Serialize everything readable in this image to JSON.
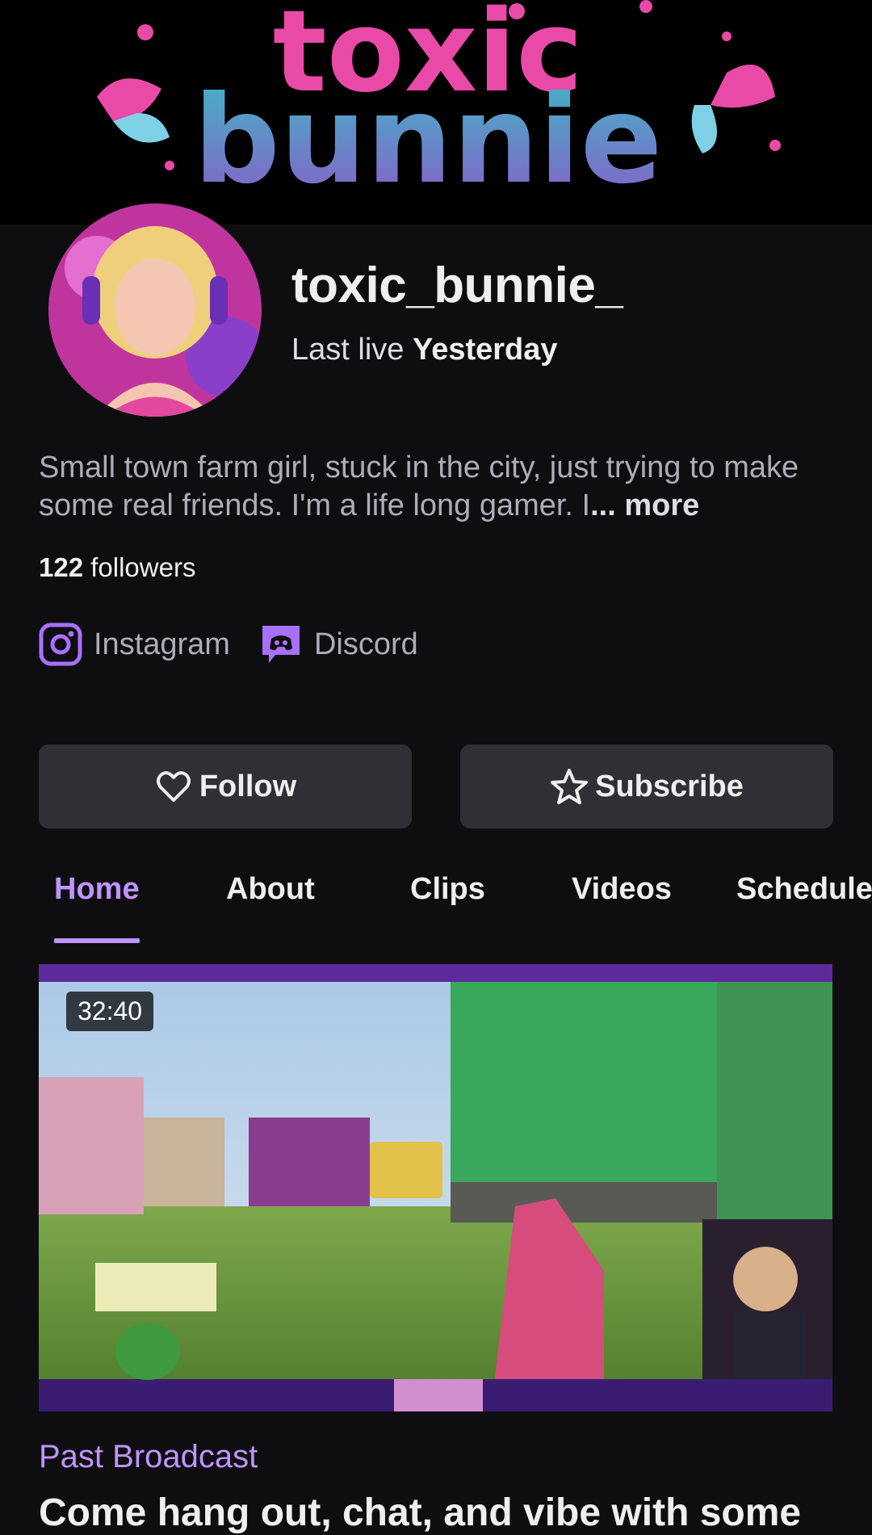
{
  "banner": {
    "logo_text_line1": "toxic",
    "logo_text_line2": "bunnie"
  },
  "profile": {
    "channel_name": "toxic_bunnie_",
    "last_live_label": "Last live",
    "last_live_value": "Yesterday",
    "bio": "Small town farm girl, stuck in the city, just trying to make some real friends. I'm a life long gamer. I",
    "bio_more": "... more",
    "followers_count": "122",
    "followers_label": "followers"
  },
  "socials": [
    {
      "label": "Instagram",
      "icon": "instagram-icon"
    },
    {
      "label": "Discord",
      "icon": "discord-icon"
    }
  ],
  "actions": {
    "follow_label": "Follow",
    "subscribe_label": "Subscribe"
  },
  "tabs": [
    {
      "label": "Home",
      "active": true
    },
    {
      "label": "About"
    },
    {
      "label": "Clips"
    },
    {
      "label": "Videos"
    },
    {
      "label": "Schedule"
    }
  ],
  "video": {
    "duration": "32:40",
    "category_label": "Past Broadcast",
    "title": "Come hang out, chat, and vibe with some"
  },
  "colors": {
    "background": "#0e0e10",
    "accent": "#bf94ff",
    "button_bg": "#2f2f35",
    "muted_text": "#adadb8"
  }
}
